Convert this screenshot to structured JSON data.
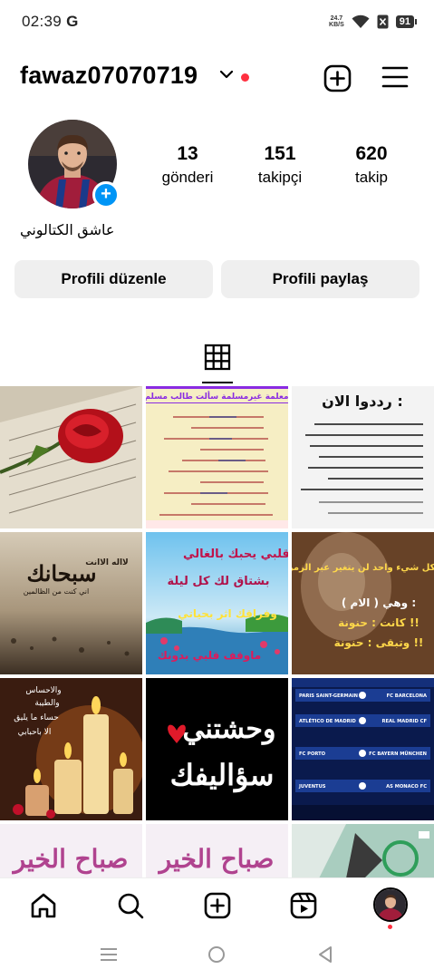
{
  "status_bar": {
    "time": "02:39",
    "carrier_glyph": "G",
    "speed_value": "24.7",
    "speed_unit": "KB/S",
    "battery": "91"
  },
  "header": {
    "username": "fawaz07070719"
  },
  "profile": {
    "display_name": "عاشق الكتالوني",
    "stats": [
      {
        "value": "13",
        "label": "gönderi"
      },
      {
        "value": "151",
        "label": "takipçi"
      },
      {
        "value": "620",
        "label": "takip"
      }
    ]
  },
  "buttons": {
    "edit": "Profili düzenle",
    "share": "Profili paylaş"
  },
  "grid": {
    "tiles": [
      {
        "name": "rose-book-post",
        "palette": [
          "#d9d2c2",
          "#c0141a"
        ],
        "texts": []
      },
      {
        "name": "arabic-dialogue-post",
        "palette": [
          "#f7efc6",
          "#8a2be2"
        ],
        "texts": [
          "معلمة غيرمسلمة سألت طالب مسلم"
        ]
      },
      {
        "name": "arabic-dua-post",
        "palette": [
          "#f2f2f2",
          "#111111"
        ],
        "texts": [
          "رددوا الان :"
        ]
      },
      {
        "name": "subhanak-post",
        "palette": [
          "#b9a58e",
          "#3c2f23"
        ],
        "texts": [
          "سبحانك",
          "لااله الاانت",
          "اني كنت من الظالمين"
        ]
      },
      {
        "name": "sea-sky-post",
        "palette": [
          "#4aa6d8",
          "#2e8b57"
        ],
        "texts": [
          "قلبي يحبك بالغالي",
          "بشتاق لك كل ليلة",
          "وفراقك اثر بحياتي",
          "ماوقف قلبي بدونك"
        ]
      },
      {
        "name": "woman-text-post",
        "palette": [
          "#c3a17a",
          "#3a1f14"
        ],
        "texts": [
          "كل شيء واحد لن يتغير عبر الزمن !!",
          "وهي ( الام ) :",
          "كانت : حنونة !!",
          "وتبقى : حنونة !!"
        ]
      },
      {
        "name": "candles-post",
        "palette": [
          "#3b1d12",
          "#ffce5a"
        ],
        "texts": [
          "والاحساس",
          "والطيبة",
          "حساء ما يليق",
          "الا باحبابي"
        ]
      },
      {
        "name": "calligraphy-heart-post",
        "palette": [
          "#000000",
          "#ffffff"
        ],
        "texts": [
          "وحشتني",
          "سؤاليفك"
        ]
      },
      {
        "name": "champions-draw-post",
        "palette": [
          "#0b1f5a",
          "#ffffff"
        ],
        "texts": [
          "PARIS SAINT-GERMAIN",
          "FC BARCELONA",
          "ATLÉTICO DE MADRID",
          "REAL MADRID CF",
          "FC PORTO",
          "FC BAYERN MÜNCHEN",
          "JUVENTUS",
          "AS MONACO FC"
        ]
      },
      {
        "name": "good-morning-post-1",
        "palette": [
          "#f4eef4",
          "#b0438f"
        ],
        "texts": [
          "صباح الخير"
        ]
      },
      {
        "name": "good-morning-post-2",
        "palette": [
          "#f4eef4",
          "#b0438f"
        ],
        "texts": [
          "صباح الخير"
        ]
      },
      {
        "name": "anime-post",
        "palette": [
          "#9ec9b8",
          "#2b2b2b"
        ],
        "texts": []
      }
    ]
  },
  "icons": {
    "add_post": "plus-square-icon",
    "menu": "hamburger-icon",
    "grid": "grid-icon",
    "home": "home-icon",
    "search": "search-icon",
    "create": "create-icon",
    "reels": "reels-icon"
  },
  "colors": {
    "accent": "#0095f6",
    "notification": "#ff3040",
    "button_bg": "#efefef"
  }
}
